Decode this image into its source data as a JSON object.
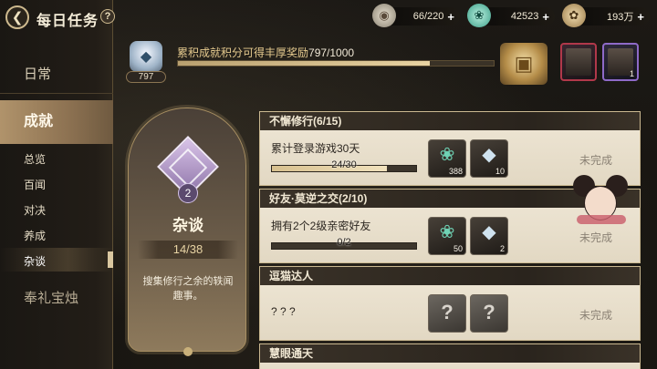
{
  "header": {
    "back_icon": "back-arrow-icon",
    "title": "每日任务",
    "help_label": "?"
  },
  "currencies": [
    {
      "icon": "stamina-icon",
      "value": "66/220",
      "plus": "+"
    },
    {
      "icon": "jade-icon",
      "value": "42523",
      "plus": "+"
    },
    {
      "icon": "coin-icon",
      "value": "193万",
      "plus": "+"
    }
  ],
  "nav": {
    "daily": "日常",
    "achievement": "成就",
    "sub_items": [
      "总览",
      "百闻",
      "对决",
      "养成",
      "杂谈"
    ],
    "active_sub": "杂谈",
    "gift": "奉礼宝烛"
  },
  "achievement_points": {
    "badge_value": "797",
    "text": "累积成就积分可得丰厚奖励",
    "count": "797/1000",
    "progress": 0.797
  },
  "reward_cards": [
    {
      "count": "1"
    }
  ],
  "category": {
    "level": "2",
    "name": "杂谈",
    "progress": "14/38",
    "description": "搜集修行之余的轶闻趣事。"
  },
  "tasks": [
    {
      "title": "不懈修行(6/15)",
      "description": "累计登录游戏30天",
      "progress_text": "24/30",
      "progress": 0.8,
      "rewards": [
        {
          "icon": "jade-icon",
          "count": "388"
        },
        {
          "icon": "cup-icon",
          "count": "10"
        }
      ],
      "status": "未完成"
    },
    {
      "title": "好友·莫逆之交(2/10)",
      "description": "拥有2个2级亲密好友",
      "progress_text": "0/2",
      "progress": 0.0,
      "rewards": [
        {
          "icon": "jade-icon",
          "count": "50"
        },
        {
          "icon": "cup-icon",
          "count": "2"
        }
      ],
      "status": "未完成"
    },
    {
      "title": "逗猫达人",
      "description": "? ? ?",
      "rewards": [
        {
          "icon": "unknown-icon",
          "label": "?"
        },
        {
          "icon": "unknown-icon",
          "label": "?"
        }
      ],
      "status": "未完成"
    },
    {
      "title": "慧眼通天"
    }
  ],
  "colors": {
    "accent_gold": "#e4c98e",
    "panel_cream": "#efe7d6",
    "header_dark": "#2a241d",
    "emblem_purple": "#8d73a8"
  }
}
